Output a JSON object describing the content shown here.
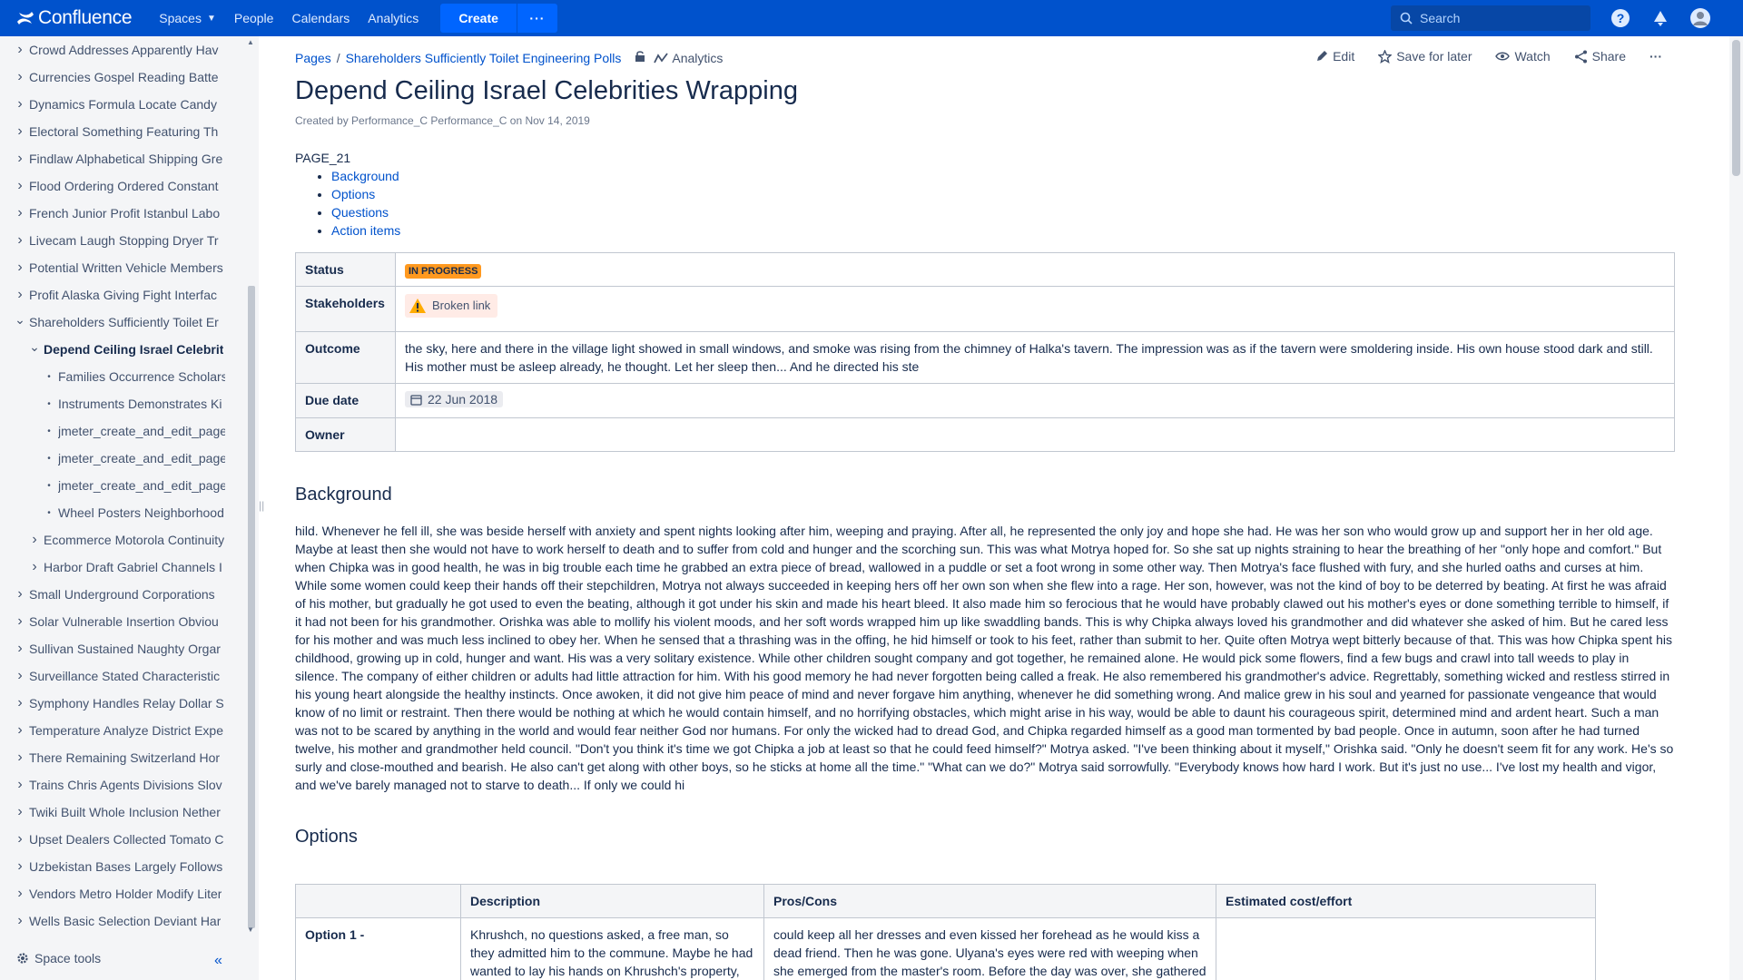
{
  "nav": {
    "logo": "Confluence",
    "spaces": "Spaces",
    "people": "People",
    "calendars": "Calendars",
    "analytics": "Analytics",
    "create": "Create",
    "more": "···",
    "search_placeholder": "Search"
  },
  "sidebar": {
    "items": [
      {
        "label": "Crowd Addresses Apparently Hav",
        "level": 0,
        "toggle": "closed"
      },
      {
        "label": "Currencies Gospel Reading Batte",
        "level": 0,
        "toggle": "closed"
      },
      {
        "label": "Dynamics Formula Locate Candy",
        "level": 0,
        "toggle": "closed"
      },
      {
        "label": "Electoral Something Featuring Th",
        "level": 0,
        "toggle": "closed"
      },
      {
        "label": "Findlaw Alphabetical Shipping Gre",
        "level": 0,
        "toggle": "closed"
      },
      {
        "label": "Flood Ordering Ordered Constant",
        "level": 0,
        "toggle": "closed"
      },
      {
        "label": "French Junior Profit Istanbul Labo",
        "level": 0,
        "toggle": "closed"
      },
      {
        "label": "Livecam Laugh Stopping Dryer Tr",
        "level": 0,
        "toggle": "closed"
      },
      {
        "label": "Potential Written Vehicle Members",
        "level": 0,
        "toggle": "closed"
      },
      {
        "label": "Profit Alaska Giving Fight Interfac",
        "level": 0,
        "toggle": "closed"
      },
      {
        "label": "Shareholders Sufficiently Toilet Er",
        "level": 0,
        "toggle": "open"
      },
      {
        "label": "Depend Ceiling Israel Celebrit",
        "level": 1,
        "toggle": "open",
        "current": true
      },
      {
        "label": "Families Occurrence Scholars",
        "level": 2,
        "toggle": "bullet"
      },
      {
        "label": "Instruments Demonstrates Ki",
        "level": 2,
        "toggle": "bullet"
      },
      {
        "label": "jmeter_create_and_edit_page",
        "level": 2,
        "toggle": "bullet"
      },
      {
        "label": "jmeter_create_and_edit_page",
        "level": 2,
        "toggle": "bullet"
      },
      {
        "label": "jmeter_create_and_edit_page",
        "level": 2,
        "toggle": "bullet"
      },
      {
        "label": "Wheel Posters Neighborhood",
        "level": 2,
        "toggle": "bullet"
      },
      {
        "label": "Ecommerce Motorola Continuity",
        "level": 1,
        "toggle": "closed"
      },
      {
        "label": "Harbor Draft Gabriel Channels I",
        "level": 1,
        "toggle": "closed"
      },
      {
        "label": "Small Underground Corporations",
        "level": 0,
        "toggle": "closed"
      },
      {
        "label": "Solar Vulnerable Insertion Obviou",
        "level": 0,
        "toggle": "closed"
      },
      {
        "label": "Sullivan Sustained Naughty Orgar",
        "level": 0,
        "toggle": "closed"
      },
      {
        "label": "Surveillance Stated Characteristic",
        "level": 0,
        "toggle": "closed"
      },
      {
        "label": "Symphony Handles Relay Dollar S",
        "level": 0,
        "toggle": "closed"
      },
      {
        "label": "Temperature Analyze District Expe",
        "level": 0,
        "toggle": "closed"
      },
      {
        "label": "There Remaining Switzerland Hor",
        "level": 0,
        "toggle": "closed"
      },
      {
        "label": "Trains Chris Agents Divisions Slov",
        "level": 0,
        "toggle": "closed"
      },
      {
        "label": "Twiki Built Whole Inclusion Nether",
        "level": 0,
        "toggle": "closed"
      },
      {
        "label": "Upset Dealers Collected Tomato C",
        "level": 0,
        "toggle": "closed"
      },
      {
        "label": "Uzbekistan Bases Largely Follows",
        "level": 0,
        "toggle": "closed"
      },
      {
        "label": "Vendors Metro Holder Modify Liter",
        "level": 0,
        "toggle": "closed"
      },
      {
        "label": "Wells Basic Selection Deviant Har",
        "level": 0,
        "toggle": "closed"
      }
    ],
    "space_tools": "Space tools"
  },
  "breadcrumb": {
    "pages": "Pages",
    "sep": "/",
    "parent": "Shareholders Sufficiently Toilet Engineering Polls",
    "analytics": "Analytics"
  },
  "actions": {
    "edit": "Edit",
    "save": "Save for later",
    "watch": "Watch",
    "share": "Share",
    "more": "···"
  },
  "page": {
    "title": "Depend Ceiling Israel Celebrities Wrapping",
    "byline": "Created by Performance_C Performance_C on Nov 14, 2019",
    "page_id": "PAGE_21",
    "toc": [
      "Background",
      "Options",
      "Questions",
      "Action items"
    ]
  },
  "props": {
    "status_label": "Status",
    "status_value": "IN PROGRESS",
    "stakeholders_label": "Stakeholders",
    "stakeholders_value": "Broken link",
    "outcome_label": "Outcome",
    "outcome_value": "the sky, here and there in the village light showed in small windows, and smoke was rising from the chimney of Halka's tavern. The impression was as if the tavern were smoldering inside. His own house stood dark and still. His mother must be asleep already, he thought. Let her sleep then... And he directed his ste",
    "due_label": "Due date",
    "due_value": "22 Jun 2018",
    "owner_label": "Owner",
    "owner_value": ""
  },
  "background": {
    "heading": "Background",
    "text": "hild. Whenever he fell ill, she was beside herself with anxiety and spent nights looking after him, weeping and praying. After all, he represented the only joy and hope she had. He was her son who would grow up and support her in her old age. Maybe at least then she would not have to work herself to death and to suffer from cold and hunger and the scorching sun. This was what Motrya hoped for. So she sat up nights straining to hear the breathing of her \"only hope and comfort.\" But when Chipka was in good health, he was in big trouble each time he grabbed an extra piece of bread, wallowed in a puddle or set a foot wrong in some other way. Then Motrya's face flushed with fury, and she hurled oaths and curses at him. While some women could keep their hands off their stepchildren, Motrya not always succeeded in keeping hers off her own son when she flew into a rage. Her son, however, was not the kind of boy to be deterred by beating. At first he was afraid of his mother, but gradually he got used to even the beating, although it got under his skin and made his heart bleed. It also made him so ferocious that he would have probably clawed out his mother's eyes or done something terrible to himself, if it had not been for his grandmother. Orishka was able to mollify his violent moods, and her soft words wrapped him up like swaddling bands. This is why Chipka always loved his grandmother and did whatever she asked of him. But he cared less for his mother and was much less inclined to obey her. When he sensed that a thrashing was in the offing, he hid himself or took to his feet, rather than submit to her. Quite often Motrya wept bitterly because of that. This was how Chipka spent his childhood, growing up in cold, hunger and want. His was a very solitary existence. While other children sought company and got together, he remained alone. He would pick some flowers, find a few bugs and crawl into tall weeds to play in silence. The company of either children or adults had little attraction for him. With his good memory he had never forgotten being called a freak. He also remembered his grandmother's advice. Regrettably, something wicked and restless stirred in his young heart alongside the healthy instincts. Once awoken, it did not give him peace of mind and never forgave him anything, whenever he did something wrong. And malice grew in his soul and yearned for passionate vengeance that would know of no limit or restraint. Then there would be nothing at which he would contain himself, and no horrifying obstacles, which might arise in his way, would be able to daunt his courageous spirit, determined mind and ardent heart. Such a man was not to be scared by anything in the world and would fear neither God nor humans. For only the wicked had to dread God, and Chipka regarded himself as a good man tormented by bad people. Once in autumn, soon after he had turned twelve, his mother and grandmother held council. \"Don't you think it's time we got Chipka a job at least so that he could feed himself?\" Motrya asked. \"I've been thinking about it myself,\" Orishka said. \"Only he doesn't seem fit for any work. He's so surly and close-mouthed and bearish. He also can't get along with other boys, so he sticks at home all the time.\" \"What can we do?\" Motrya said sorrowfully. \"Everybody knows how hard I work. But it's just no use... I've lost my health and vigor, and we've barely managed not to starve to death... If only we could hi"
  },
  "options": {
    "heading": "Options",
    "headers": [
      "",
      "Description",
      "Pros/Cons",
      "Estimated cost/effort"
    ],
    "row1": {
      "label": "Option 1 -",
      "description": "Khrushch, no questions asked, a free man, so they admitted him to the commune. Maybe he had wanted to lay his hands on Khrushch's property, but good people had carried it away bit by bit long",
      "pros_cons": "could keep all her dresses and even kissed her forehead as he would kiss a dead friend. Then he was gone. Ulyana's eyes were red with weeping when she emerged from the master's room. Before the day was over, she gathered all the things the master had let her keep and said good-bye to her",
      "cost": ""
    }
  }
}
